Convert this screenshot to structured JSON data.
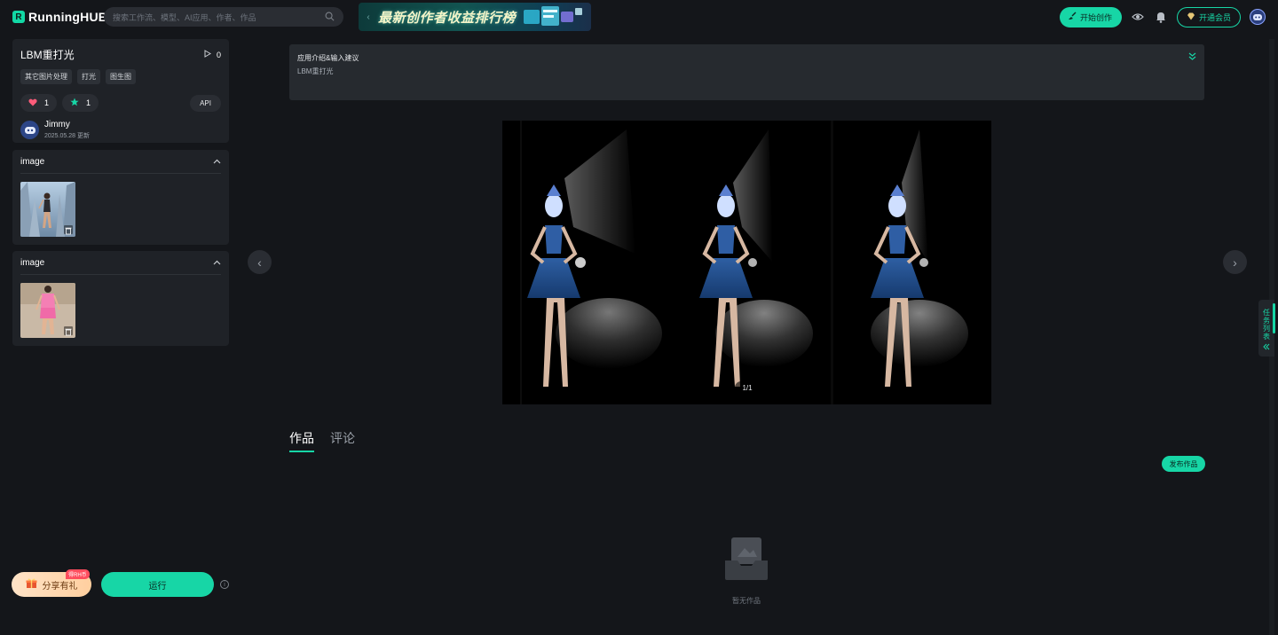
{
  "header": {
    "brand": "RunningHUB",
    "brand_mark": "R",
    "search_placeholder": "搜索工作流、模型、AI应用、作者、作品",
    "banner_text": "最新创作者收益排行榜",
    "create_label": "开始创作",
    "vip_label": "开通会员",
    "icons": [
      "search-icon",
      "brush-icon",
      "eye-icon",
      "bell-icon",
      "diamond-icon",
      "avatar"
    ]
  },
  "app": {
    "title": "LBM重打光",
    "run_count": "0",
    "tags": [
      "其它图片处理",
      "打光",
      "图生图"
    ],
    "likes": "1",
    "favorites": "1",
    "api_label": "API",
    "author_name": "Jimmy",
    "author_date": "2025.05.28 更新"
  },
  "inputs": [
    {
      "label": "image"
    },
    {
      "label": "image"
    }
  ],
  "actions": {
    "share_label": "分享有礼",
    "share_badge": "得RH币",
    "run_label": "运行",
    "info_glyph": "i"
  },
  "intro": {
    "title": "应用介绍&输入建议",
    "subtitle": "LBM重打光"
  },
  "viewer": {
    "counter": "1/1"
  },
  "tabs": [
    {
      "label": "作品",
      "active": true
    },
    {
      "label": "评论",
      "active": false
    }
  ],
  "works": {
    "publish_label": "发布作品",
    "empty_text": "暂无作品"
  },
  "task_panel": {
    "label": "任务列表"
  },
  "colors": {
    "accent": "#17d6a6",
    "background": "#14161a",
    "panel": "#1f2227"
  }
}
